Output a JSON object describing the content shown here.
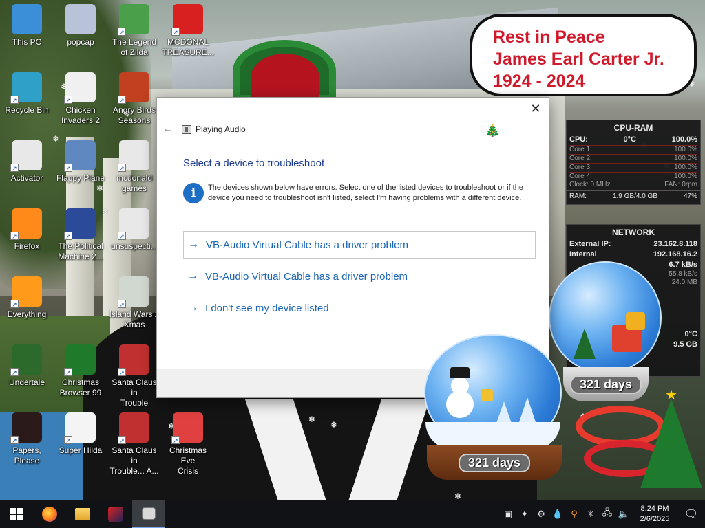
{
  "desktop_icons": [
    {
      "label": "This PC",
      "icon": "this-pc-icon"
    },
    {
      "label": "popcap",
      "icon": "popcap-icon"
    },
    {
      "label": "The Legend\nof Zilda",
      "icon": "legend-of-zilda-icon"
    },
    {
      "label": "MCDONAL\nTREASURE...",
      "icon": "mcdonald-treasure-icon"
    },
    {
      "label": "Recycle Bin",
      "icon": "recycle-bin-icon"
    },
    {
      "label": "Chicken\nInvaders 2",
      "icon": "chicken-invaders-icon"
    },
    {
      "label": "Angry Birds\nSeasons",
      "icon": "angry-birds-icon"
    },
    {
      "label": "Activator",
      "icon": "activator-icon"
    },
    {
      "label": "Flappy Plane",
      "icon": "flappy-plane-icon"
    },
    {
      "label": "mcdonald\ngames",
      "icon": "mcdonald-games-icon"
    },
    {
      "label": "Firefox",
      "icon": "firefox-icon"
    },
    {
      "label": "The Political\nMachine 2...",
      "icon": "political-machine-icon"
    },
    {
      "label": "unsuspecti...",
      "icon": "unsuspecting-icon"
    },
    {
      "label": "Everything",
      "icon": "everything-search-icon"
    },
    {
      "label": "Island Wars 2\nXmas",
      "icon": "island-wars-icon"
    },
    {
      "label": "Undertale",
      "icon": "undertale-icon"
    },
    {
      "label": "Christmas\nBrowser 99",
      "icon": "christmas-browser-icon"
    },
    {
      "label": "Santa Claus in\nTrouble",
      "icon": "santa-claus-icon"
    },
    {
      "label": "Papers, Please",
      "icon": "papers-please-icon"
    },
    {
      "label": "Super Hilda",
      "icon": "super-hilda-icon"
    },
    {
      "label": "Santa Claus in\nTrouble... A...",
      "icon": "santa-claus-2-icon"
    },
    {
      "label": "Christmas Eve\nCrisis",
      "icon": "christmas-eve-icon"
    }
  ],
  "rip_note": {
    "line1": "Rest in Peace",
    "line2": "James Earl Carter Jr.",
    "line3": "1924 - 2024"
  },
  "cpu_gadget": {
    "title": "CPU-RAM",
    "cpu_label": "CPU:",
    "cpu_temp": "0°C",
    "cpu_value": "100.0%",
    "cores": [
      {
        "label": "Core 1:",
        "value": "100.0%"
      },
      {
        "label": "Core 2:",
        "value": "100.0%"
      },
      {
        "label": "Core 3:",
        "value": "100.0%"
      },
      {
        "label": "Core 4:",
        "value": "100.0%"
      }
    ],
    "clock_label": "Clock: 0 MHz",
    "fan_label": "FAN: 0rpm",
    "ram_label": "RAM:",
    "ram_value": "1.9 GB/4.0 GB",
    "ram_percent": "47%"
  },
  "network_gadget": {
    "title": "NETWORK",
    "external_label": "External IP:",
    "external_ip": "23.162.8.118",
    "internal_label": "Internal",
    "internal_ip": "192.168.16.2",
    "speed1": "6.7 kB/s",
    "speed2": "55.8 kB/s",
    "total": "24.0 MB",
    "temp": "0°C",
    "size": "9.5 GB"
  },
  "dialog": {
    "app_title": "Playing Audio",
    "heading": "Select a device to troubleshoot",
    "info_text": "The devices shown below have errors. Select one of the listed devices to troubleshoot or if the device you need to troubleshoot isn't listed, select I'm having problems with a different device.",
    "options": [
      {
        "label": "VB-Audio Virtual Cable has a driver problem",
        "selected": true
      },
      {
        "label": "VB-Audio Virtual Cable has a driver problem",
        "selected": false
      },
      {
        "label": "I don't see my device listed",
        "selected": false
      }
    ],
    "close_glyph": "✕",
    "back_glyph": "←",
    "arrow_glyph": "→",
    "info_glyph": "i"
  },
  "globes": {
    "front_days": "321 days",
    "back_days": "321 days"
  },
  "taskbar": {
    "apps": [
      "start-button",
      "firefox-taskbar-button",
      "file-explorer-taskbar-button",
      "game-taskbar-button",
      "troubleshooter-taskbar-button"
    ],
    "time": "8:24 PM",
    "date": "2/6/2025"
  },
  "colors": {
    "dialog_heading": "#1e3c8a",
    "link_blue": "#1a66b5",
    "info_blue": "#1c6fc4",
    "rip_red": "#d0192b",
    "taskbar_bg": "#101216"
  }
}
